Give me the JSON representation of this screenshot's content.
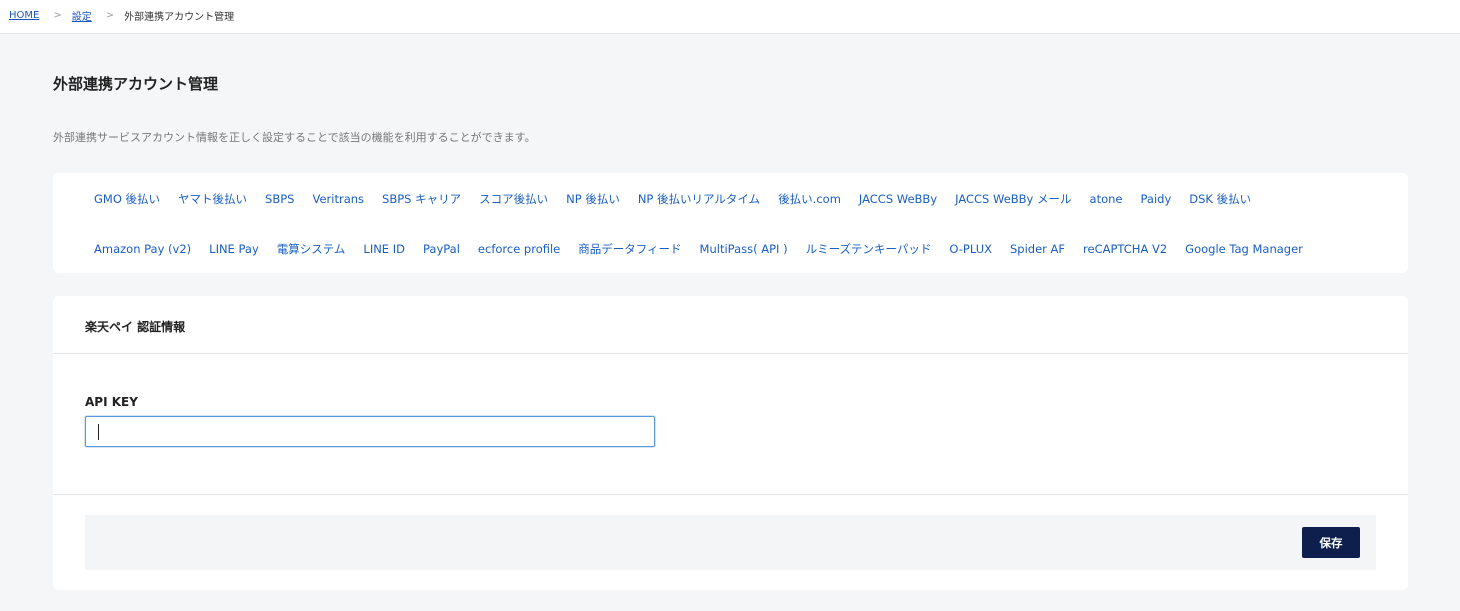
{
  "breadcrumb": {
    "home": "HOME",
    "settings": "設定",
    "current": "外部連携アカウント管理",
    "separator": ">"
  },
  "page": {
    "title": "外部連携アカウント管理",
    "description": "外部連携サービスアカウント情報を正しく設定することで該当の機能を利用することができます。"
  },
  "nav": {
    "row1": [
      "GMO 後払い",
      "ヤマト後払い",
      "SBPS",
      "Veritrans",
      "SBPS キャリア",
      "スコア後払い",
      "NP 後払い",
      "NP 後払いリアルタイム",
      "後払い.com",
      "JACCS WeBBy",
      "JACCS WeBBy メール",
      "atone",
      "Paidy",
      "DSK 後払い"
    ],
    "row2": [
      "Amazon Pay (v2)",
      "LINE Pay",
      "電算システム",
      "LINE ID",
      "PayPal",
      "ecforce profile",
      "商品データフィード",
      "MultiPass( API )",
      "ルミーズテンキーパッド",
      "O-PLUX",
      "Spider AF",
      "reCAPTCHA V2",
      "Google Tag Manager"
    ]
  },
  "form": {
    "title": "楽天ペイ 認証情報",
    "api_key_label": "API KEY",
    "api_key_value": "",
    "save_label": "保存"
  },
  "colors": {
    "link": "#1a5fc2",
    "primary_button": "#0e1f4d",
    "background": "#f4f6f7"
  }
}
